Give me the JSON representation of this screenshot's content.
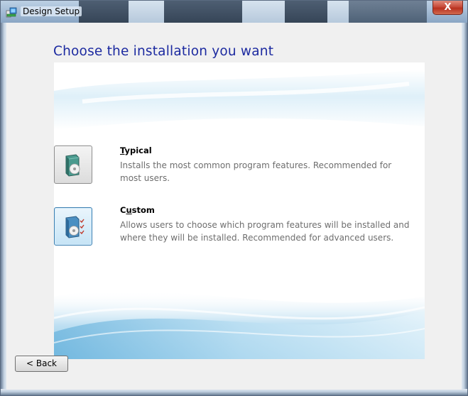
{
  "window": {
    "title": "Design Setup",
    "close_label": "X"
  },
  "page": {
    "heading": "Choose the installation you want"
  },
  "options": [
    {
      "title_mnemonic": "T",
      "title_rest": "ypical",
      "description": "Installs the most common program features. Recommended for most users.",
      "icon": "disc-package-icon",
      "selected": false
    },
    {
      "title_first": "C",
      "title_mnemonic": "u",
      "title_rest": "stom",
      "description": "Allows users to choose which program features will be installed and where they will be installed. Recommended for advanced users.",
      "icon": "custom-package-icon",
      "selected": true
    }
  ],
  "nav": {
    "back_label": "< Back"
  },
  "colors": {
    "heading": "#1c2aa0",
    "description": "#6e6e6e",
    "selected_border": "#3c7fb1"
  }
}
